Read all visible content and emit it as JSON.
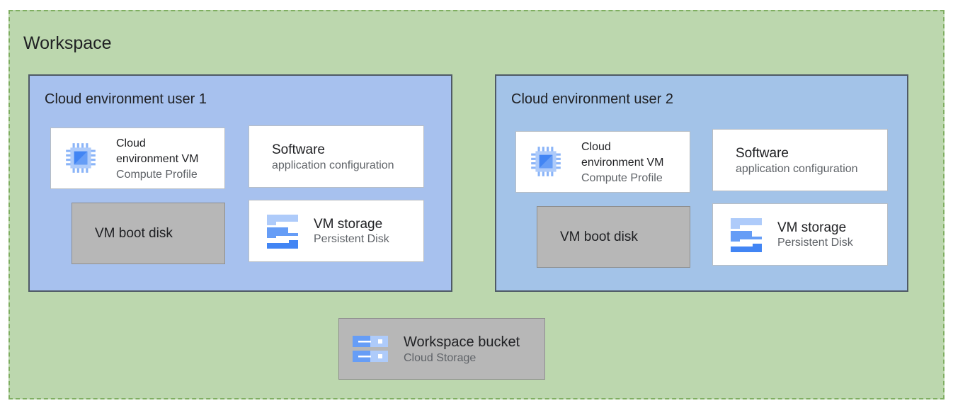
{
  "workspace": {
    "title": "Workspace"
  },
  "environments": [
    {
      "title": "Cloud environment user 1",
      "vm": {
        "line1": "Cloud",
        "line2": "environment VM",
        "sub": "Compute Profile",
        "icon": "cpu-chip-icon"
      },
      "software": {
        "title": "Software",
        "sub": "application configuration"
      },
      "boot_disk": {
        "title": "VM boot disk"
      },
      "storage": {
        "title": "VM storage",
        "sub": "Persistent Disk",
        "icon": "persistent-disk-icon"
      }
    },
    {
      "title": "Cloud environment user 2",
      "vm": {
        "line1": "Cloud",
        "line2": "environment VM",
        "sub": "Compute Profile",
        "icon": "cpu-chip-icon"
      },
      "software": {
        "title": "Software",
        "sub": "application configuration"
      },
      "boot_disk": {
        "title": "VM boot disk"
      },
      "storage": {
        "title": "VM storage",
        "sub": "Persistent Disk",
        "icon": "persistent-disk-icon"
      }
    }
  ],
  "bucket": {
    "title": "Workspace bucket",
    "sub": "Cloud Storage",
    "icon": "cloud-storage-icon"
  },
  "colors": {
    "workspace_fill": "#bcd7ae",
    "workspace_border": "#7fae61",
    "env1_fill": "#a7c1ee",
    "env2_fill": "#a3c3e8",
    "grey_card": "#b7b7b7",
    "icon_blue_dark": "#4285f4",
    "icon_blue_light": "#aecbfa"
  }
}
